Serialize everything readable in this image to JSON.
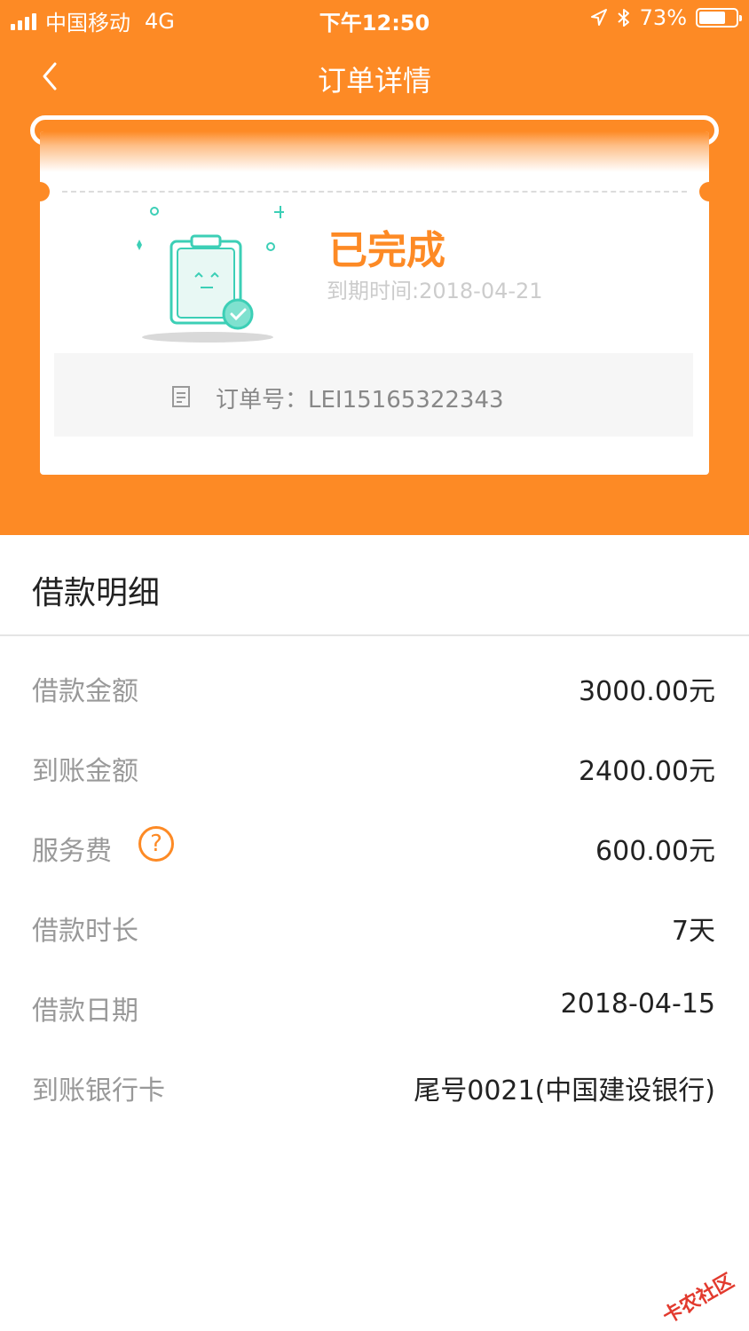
{
  "status_bar": {
    "carrier": "中国移动",
    "network": "4G",
    "time": "下午12:50",
    "battery": "73%",
    "battery_level": 0.73,
    "icons": [
      "location-arrow-icon",
      "bluetooth-icon"
    ]
  },
  "nav": {
    "title": "订单详情",
    "back_icon": "chevron-left-icon"
  },
  "order_card": {
    "status": "已完成",
    "due_date": "到期时间:2018-04-21",
    "order_number": "订单号：LEI15165322343",
    "illustration_icon": "clipboard-check-icon"
  },
  "details": {
    "title": "借款明细",
    "rows": [
      {
        "label": "借款金额",
        "value": "3000.00元"
      },
      {
        "label": "到账金额",
        "value": "2400.00元"
      },
      {
        "label": "服务费",
        "value": "600.00元",
        "help": "?"
      },
      {
        "label": "借款时长",
        "value": "7天"
      },
      {
        "label": "借款日期",
        "value": "2018-04-15"
      },
      {
        "label": "到账银行卡",
        "value": "尾号0021(中国建设银行)"
      }
    ]
  },
  "watermark": "卡农社区",
  "colors": {
    "accent": "#fd8a25",
    "teal": "#3ccfb6",
    "label_gray": "#999999",
    "value_dark": "#222222"
  }
}
